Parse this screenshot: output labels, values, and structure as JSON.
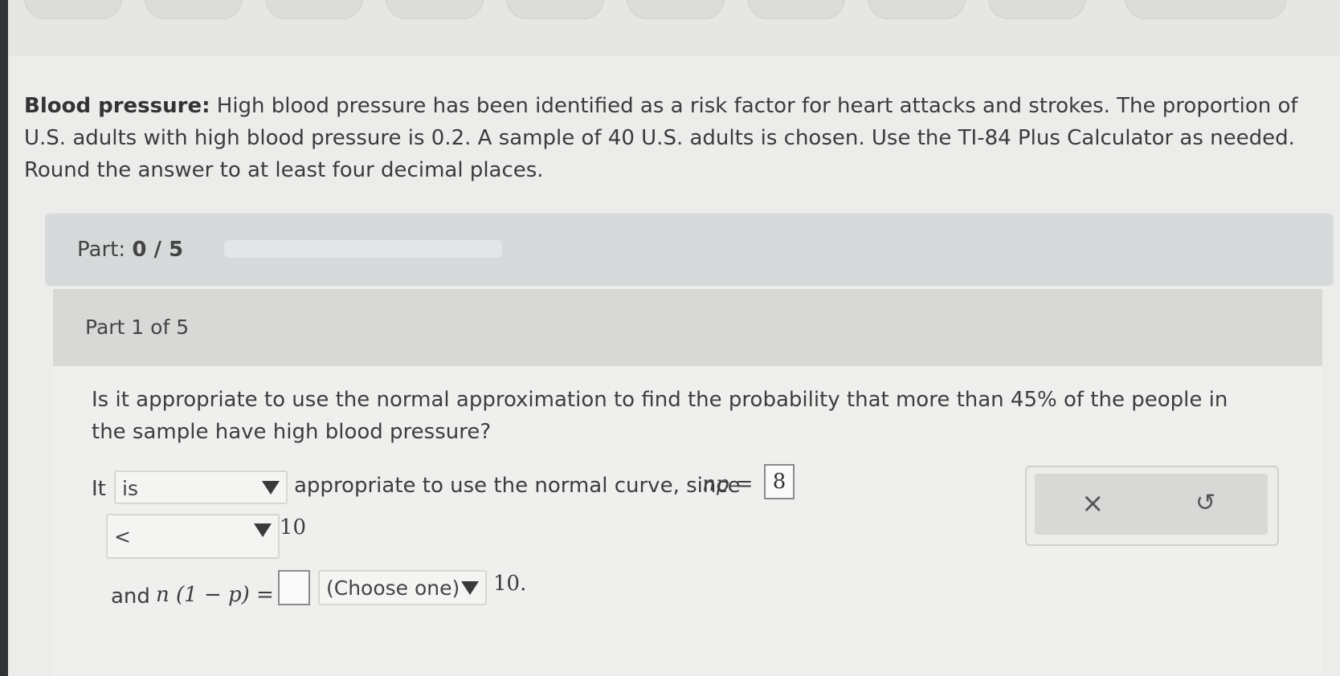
{
  "problem": {
    "title": "Blood pressure:",
    "text": "High blood pressure has been identified as a risk factor for heart attacks and strokes. The proportion of U.S. adults with high blood pressure is 0.2. A sample of 40 U.S. adults is chosen. Use the TI-84 Plus Calculator as needed. Round the answer to at least four decimal places."
  },
  "part_progress": {
    "label": "Part:",
    "value": "0 / 5",
    "fraction": 0.0
  },
  "part_header": "Part 1 of 5",
  "question": "Is it appropriate to use the normal approximation to find the probability that more than 45% of the people in the sample have high blood pressure?",
  "answer": {
    "it_label": "It",
    "select1_value": "is",
    "after_select1": "appropriate to use the normal curve, since",
    "np_label": "np =",
    "np_value": "8",
    "select2_value": "<",
    "after_select2": "10",
    "and_label": "and",
    "n1p_label": "n (1 − p) =",
    "n1p_value": "",
    "select3_value": "(Choose one)",
    "after_select3": "10."
  },
  "tools": {
    "clear_icon": "×",
    "undo_icon": "↺"
  },
  "colors": {
    "background": "#ececea",
    "part_bar": "#d6dada",
    "panel_header": "#d8d8d6"
  }
}
